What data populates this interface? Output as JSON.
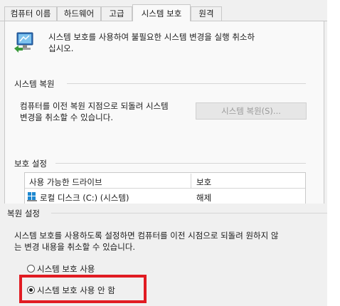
{
  "tabs": [
    "컴퓨터 이름",
    "하드웨어",
    "고급",
    "시스템 보호",
    "원격"
  ],
  "intro_text_line1": "시스템 보호를 사용하여 불필요한 시스템 변경을 실행 취소하",
  "intro_text_line2": "십시오.",
  "restore_section": {
    "title": "시스템 복원",
    "desc_line1": "컴퓨터를 이전 복원 지점으로 되돌려 시스템",
    "desc_line2": "변경을 취소할 수 있습니다.",
    "button_label": "시스템 복원(S)..."
  },
  "protection_section": {
    "title": "보호 설정",
    "col_drive": "사용 가능한 드라이브",
    "col_protection": "보호",
    "rows": [
      {
        "drive": "로컬 디스크 (C:) (시스템)",
        "status": "해제"
      }
    ]
  },
  "restore_settings": {
    "title": "복원 설정",
    "desc_line1": "시스템 보호를 사용하도록 설정하면 컴퓨터를 이전 시점으로 되돌려 원하지 않",
    "desc_line2": "는 변경 내용을 취소할 수 있습니다.",
    "option_on": "시스템 보호 사용",
    "option_off": "시스템 보호 사용 안 함",
    "selected": "option_off"
  },
  "colors": {
    "highlight_box": "#e11b22"
  },
  "icons": [
    "system-protection-icon",
    "drive-icon"
  ]
}
